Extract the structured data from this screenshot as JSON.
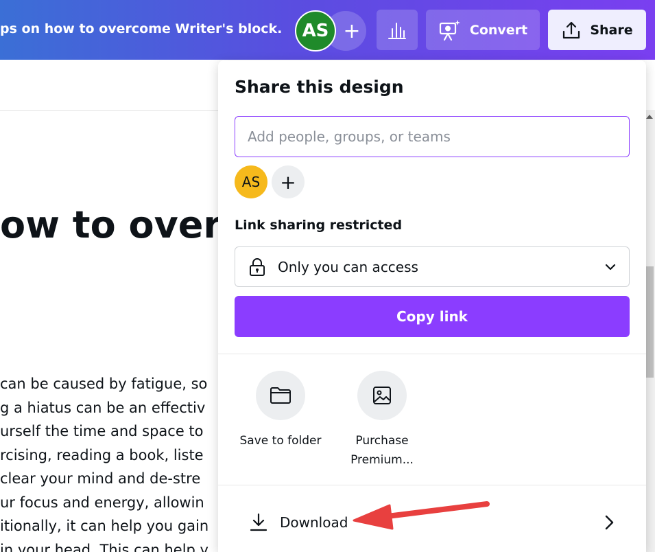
{
  "header": {
    "doc_title": "ps on how to overcome Writer's block.",
    "collaborator_initials": "AS",
    "add_collaborator": "+",
    "convert_label": "Convert",
    "share_label": "Share"
  },
  "document": {
    "heading": "ow to over",
    "lines": [
      "can be caused by fatigue, so",
      "g a hiatus can be an effectiv",
      "urself the time and space to",
      "rcising, reading a book, liste",
      "clear your mind and de-stre",
      "ur focus and energy, allowin",
      "itionally, it can help you gain",
      "in your head. This can help y"
    ]
  },
  "share_panel": {
    "title": "Share this design",
    "people_placeholder": "Add people, groups, or teams",
    "people_value": "",
    "owner_initials": "AS",
    "add_person": "+",
    "link_sharing_label": "Link sharing restricted",
    "access_value": "Only you can access",
    "copy_link_label": "Copy link",
    "actions": [
      {
        "label": "Save to folder",
        "icon": "folder-icon"
      },
      {
        "label": "Purchase Premium...",
        "icon": "image-icon"
      }
    ],
    "download_label": "Download"
  },
  "colors": {
    "accent": "#8b3dff",
    "annotation_arrow": "#e8403f",
    "avatar_green": "#1f8a2a",
    "avatar_yellow": "#f6b91c"
  }
}
